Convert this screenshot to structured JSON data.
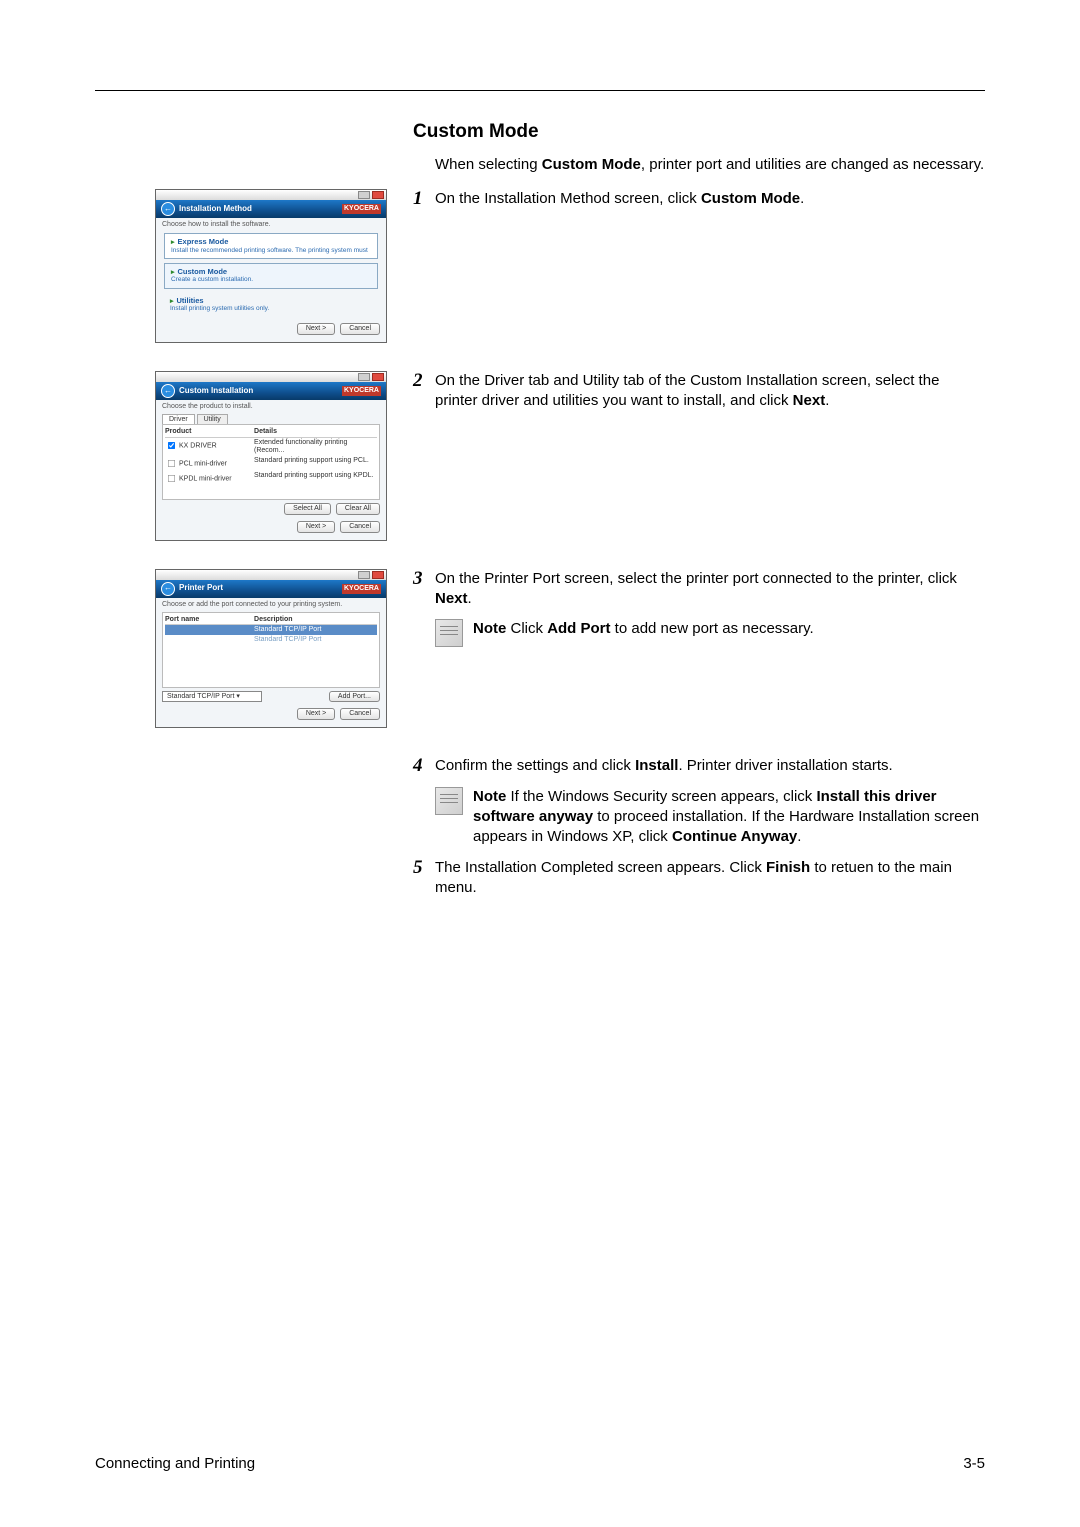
{
  "heading": "Custom Mode",
  "intro_prefix": "When selecting ",
  "intro_bold": "Custom Mode",
  "intro_suffix": ", printer port and utilities are changed as necessary.",
  "step1": {
    "num": "1",
    "t1": "On the Installation Method screen, click ",
    "b1": "Custom Mode",
    "t2": "."
  },
  "step2": {
    "num": "2",
    "t1": "On the Driver tab and Utility tab of the Custom Installation screen, select the printer driver and utilities you want to install, and click ",
    "b1": "Next",
    "t2": "."
  },
  "step3": {
    "num": "3",
    "t1": "On the Printer Port screen, select the printer port connected to the printer, click ",
    "b1": "Next",
    "t2": ".",
    "note_label": "Note",
    "note_t1": "  Click ",
    "note_b1": "Add Port",
    "note_t2": " to add new port as necessary."
  },
  "step4": {
    "num": "4",
    "t1": "Confirm the settings and click ",
    "b1": "Install",
    "t2": ". Printer driver installation starts.",
    "note_label": "Note",
    "note_t1": "  If the Windows Security screen appears, click ",
    "note_b1": "Install this driver software anyway",
    "note_t2": " to proceed installation. If the Hardware Installation screen appears in Windows XP, click ",
    "note_b2": "Continue Anyway",
    "note_t3": "."
  },
  "step5": {
    "num": "5",
    "t1": "The Installation Completed screen appears. Click ",
    "b1": "Finish",
    "t2": " to retuen to the main menu."
  },
  "shot1": {
    "title": "Installation Method",
    "brand": "KYOCERA",
    "hint": "Choose how to install the software.",
    "opt1_title": "Express Mode",
    "opt1_desc": "Install the recommended printing software. The printing system must",
    "opt2_title": "Custom Mode",
    "opt2_desc": "Create a custom installation.",
    "opt3_title": "Utilities",
    "opt3_desc": "Install printing system utilities only.",
    "next": "Next >",
    "cancel": "Cancel"
  },
  "shot2": {
    "title": "Custom Installation",
    "brand": "KYOCERA",
    "hint": "Choose the product to install.",
    "tab_driver": "Driver",
    "tab_utility": "Utility",
    "col_product": "Product",
    "col_details": "Details",
    "r1_p": "KX DRIVER",
    "r1_d": "Extended functionality printing (Recom...",
    "r2_p": "PCL mini-driver",
    "r2_d": "Standard printing support using PCL.",
    "r3_p": "KPDL mini-driver",
    "r3_d": "Standard printing support using KPDL.",
    "select_all": "Select All",
    "clear_all": "Clear All",
    "next": "Next >",
    "cancel": "Cancel"
  },
  "shot3": {
    "title": "Printer Port",
    "brand": "KYOCERA",
    "hint": "Choose or add the port connected to your printing system.",
    "col_port": "Port name",
    "col_desc": "Description",
    "row_sel_desc": "Standard TCP/IP Port",
    "dd_label": "Standard TCP/IP Port",
    "add_port": "Add Port...",
    "next": "Next >",
    "cancel": "Cancel"
  },
  "footer_left": "Connecting and Printing",
  "footer_right": "3-5"
}
